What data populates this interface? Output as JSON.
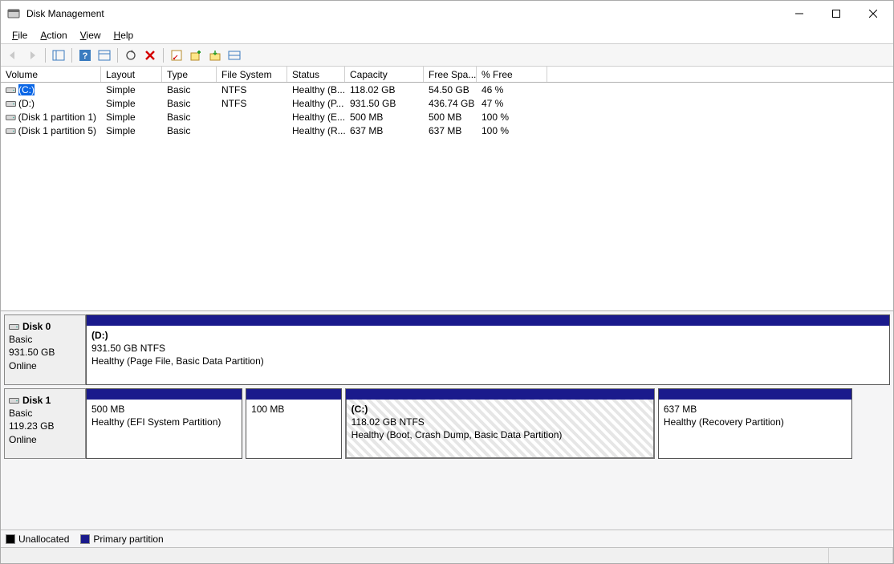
{
  "window": {
    "title": "Disk Management"
  },
  "menu": {
    "file": "File",
    "action": "Action",
    "view": "View",
    "help": "Help"
  },
  "columns": {
    "volume": "Volume",
    "layout": "Layout",
    "type": "Type",
    "filesystem": "File System",
    "status": "Status",
    "capacity": "Capacity",
    "freespace": "Free Spa...",
    "pctfree": "% Free"
  },
  "volumes": [
    {
      "name": "(C:)",
      "layout": "Simple",
      "type": "Basic",
      "fs": "NTFS",
      "status": "Healthy (B...",
      "capacity": "118.02 GB",
      "free": "54.50 GB",
      "pct": "46 %",
      "selected": true
    },
    {
      "name": "(D:)",
      "layout": "Simple",
      "type": "Basic",
      "fs": "NTFS",
      "status": "Healthy (P...",
      "capacity": "931.50 GB",
      "free": "436.74 GB",
      "pct": "47 %",
      "selected": false
    },
    {
      "name": "(Disk 1 partition 1)",
      "layout": "Simple",
      "type": "Basic",
      "fs": "",
      "status": "Healthy (E...",
      "capacity": "500 MB",
      "free": "500 MB",
      "pct": "100 %",
      "selected": false
    },
    {
      "name": "(Disk 1 partition 5)",
      "layout": "Simple",
      "type": "Basic",
      "fs": "",
      "status": "Healthy (R...",
      "capacity": "637 MB",
      "free": "637 MB",
      "pct": "100 %",
      "selected": false
    }
  ],
  "disks": [
    {
      "name": "Disk 0",
      "type": "Basic",
      "size": "931.50 GB",
      "status": "Online",
      "partitions": [
        {
          "label": "(D:)",
          "size": "931.50 GB NTFS",
          "desc": "Healthy (Page File, Basic Data Partition)",
          "flex": 1,
          "selected": false
        }
      ]
    },
    {
      "name": "Disk 1",
      "type": "Basic",
      "size": "119.23 GB",
      "status": "Online",
      "partitions": [
        {
          "label": "",
          "size": "500 MB",
          "desc": "Healthy (EFI System Partition)",
          "flex": 0.197,
          "selected": false
        },
        {
          "label": "",
          "size": "100 MB",
          "desc": "",
          "flex": 0.12,
          "selected": false
        },
        {
          "label": "(C:)",
          "size": "118.02 GB NTFS",
          "desc": "Healthy (Boot, Crash Dump, Basic Data Partition)",
          "flex": 0.39,
          "selected": true
        },
        {
          "label": "",
          "size": "637 MB",
          "desc": "Healthy (Recovery Partition)",
          "flex": 0.245,
          "selected": false
        }
      ]
    }
  ],
  "legend": {
    "unallocated": "Unallocated",
    "primary": "Primary partition"
  }
}
